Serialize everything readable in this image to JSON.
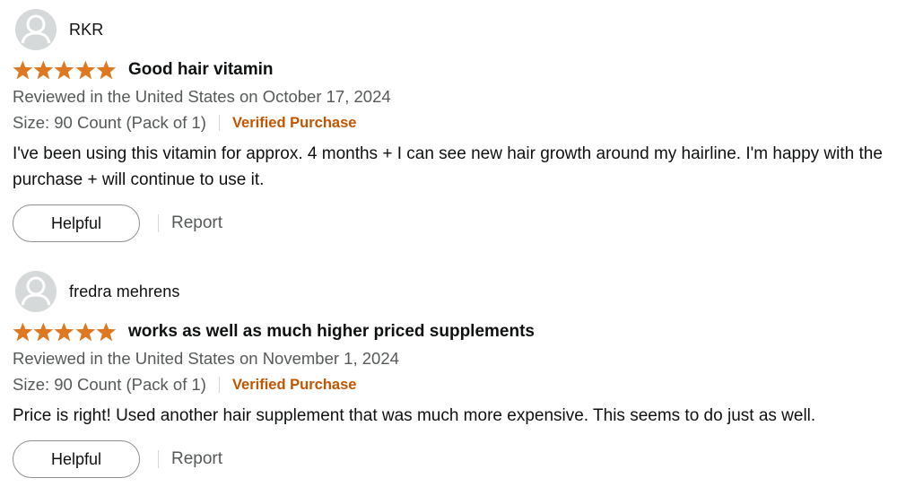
{
  "reviews": [
    {
      "profile_name": "RKR",
      "rating": 5,
      "title": "Good hair vitamin",
      "date": "Reviewed in the United States on October 17, 2024",
      "size": "Size: 90 Count (Pack of 1)",
      "verified": "Verified Purchase",
      "body": "I've been using this vitamin for approx. 4 months + I can see new hair growth around my hairline. I'm happy with the purchase + will continue to use it.",
      "helpful_label": "Helpful",
      "report_label": "Report"
    },
    {
      "profile_name": "fredra mehrens",
      "rating": 5,
      "title": "works as well as much higher priced supplements",
      "date": "Reviewed in the United States on November 1, 2024",
      "size": "Size: 90 Count (Pack of 1)",
      "verified": "Verified Purchase",
      "body": "Price is right! Used another hair supplement that was much more expensive. This seems to do just as well.",
      "helpful_label": "Helpful",
      "report_label": "Report"
    }
  ],
  "colors": {
    "star": "#de7921",
    "verified": "#c45500",
    "muted_text": "#565959",
    "avatar_bg": "#d5d9d9"
  },
  "icons": {
    "avatar": "default-avatar-icon",
    "star": "star-filled-icon"
  }
}
